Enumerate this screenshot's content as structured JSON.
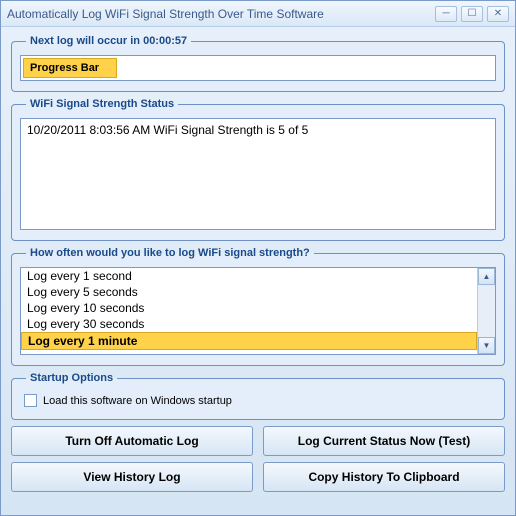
{
  "window": {
    "title": "Automatically Log WiFi Signal Strength Over Time Software"
  },
  "nextLog": {
    "legend": "Next log will occur in 00:00:57",
    "progressLabel": "Progress Bar"
  },
  "status": {
    "legend": "WiFi Signal Strength Status",
    "entries": [
      "10/20/2011 8:03:56 AM WiFi Signal Strength is 5 of 5"
    ]
  },
  "frequency": {
    "legend": "How often would you like to log WiFi signal strength?",
    "options": [
      "Log every 1 second",
      "Log every 5 seconds",
      "Log every 10 seconds",
      "Log every 30 seconds",
      "Log every 1 minute"
    ],
    "selectedIndex": 4
  },
  "startup": {
    "legend": "Startup Options",
    "checkboxLabel": "Load this software on Windows startup",
    "checked": false
  },
  "buttons": {
    "turnOff": "Turn Off Automatic Log",
    "logNow": "Log Current Status Now (Test)",
    "viewHistory": "View History Log",
    "copyHistory": "Copy History To Clipboard"
  }
}
